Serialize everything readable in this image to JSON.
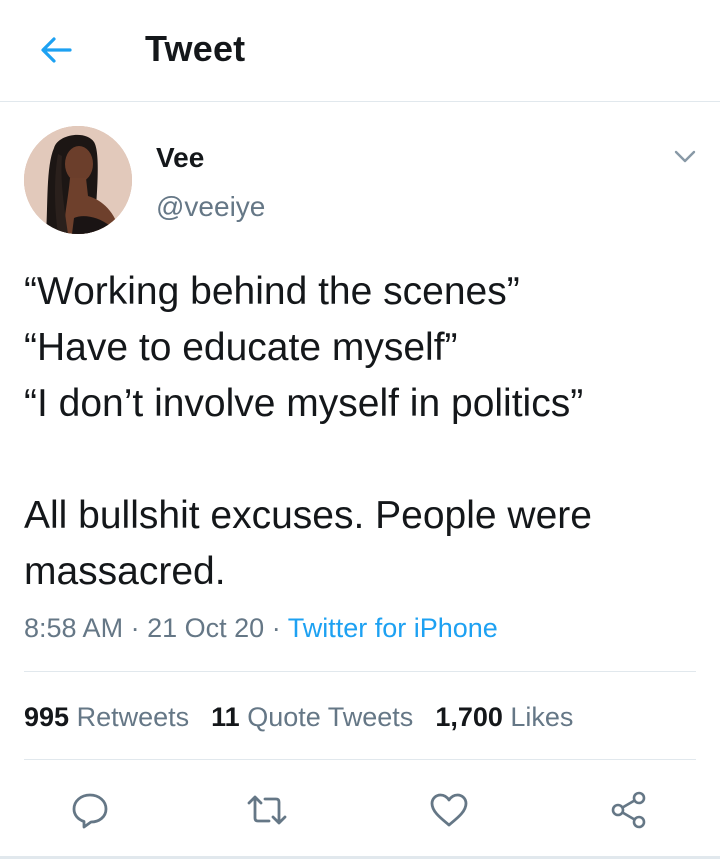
{
  "header": {
    "title": "Tweet",
    "back_icon": "arrow-left-icon"
  },
  "colors": {
    "accent": "#1da1f2",
    "text": "#14171a",
    "secondary": "#657786",
    "border": "#e1e8ed"
  },
  "tweet": {
    "author": {
      "display_name": "Vee",
      "handle": "@veeiye"
    },
    "text_lines": [
      "“Working behind the scenes”",
      "“Have to educate myself”",
      "“I don’t involve myself in politics”",
      "",
      "All bullshit excuses. People were",
      "massacred."
    ],
    "time": "8:58 AM",
    "separator": "·",
    "date": "21 Oct 20",
    "source": "Twitter for iPhone"
  },
  "stats": [
    {
      "count": "995",
      "label": "Retweets"
    },
    {
      "count": "11",
      "label": "Quote Tweets"
    },
    {
      "count": "1,700",
      "label": "Likes"
    }
  ],
  "actions": [
    {
      "name": "reply-icon"
    },
    {
      "name": "retweet-icon"
    },
    {
      "name": "like-icon"
    },
    {
      "name": "share-icon"
    }
  ]
}
